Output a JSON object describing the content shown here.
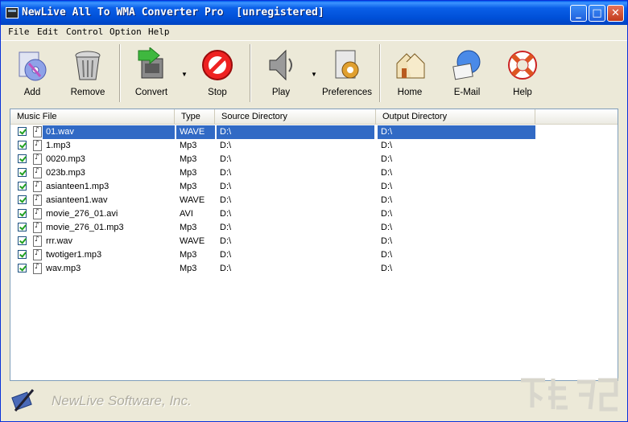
{
  "window": {
    "title": "NewLive All To WMA Converter Pro  [unregistered]",
    "controls": {
      "minimize": "_",
      "maximize": "□",
      "close": "✕"
    }
  },
  "menu": [
    "File",
    "Edit",
    "Control",
    "Option",
    "Help"
  ],
  "toolbar": {
    "add": "Add",
    "remove": "Remove",
    "convert": "Convert",
    "stop": "Stop",
    "play": "Play",
    "preferences": "Preferences",
    "home": "Home",
    "email": "E-Mail",
    "help": "Help"
  },
  "columns": [
    "Music File",
    "Type",
    "Source Directory",
    "Output Directory"
  ],
  "files": [
    {
      "name": "01.wav",
      "type": "WAVE",
      "src": "D:\\",
      "out": "D:\\",
      "selected": true
    },
    {
      "name": "1.mp3",
      "type": "Mp3",
      "src": "D:\\",
      "out": "D:\\"
    },
    {
      "name": "0020.mp3",
      "type": "Mp3",
      "src": "D:\\",
      "out": "D:\\"
    },
    {
      "name": "023b.mp3",
      "type": "Mp3",
      "src": "D:\\",
      "out": "D:\\"
    },
    {
      "name": "asianteen1.mp3",
      "type": "Mp3",
      "src": "D:\\",
      "out": "D:\\"
    },
    {
      "name": "asianteen1.wav",
      "type": "WAVE",
      "src": "D:\\",
      "out": "D:\\"
    },
    {
      "name": "movie_276_01.avi",
      "type": "AVI",
      "src": "D:\\",
      "out": "D:\\"
    },
    {
      "name": "movie_276_01.mp3",
      "type": "Mp3",
      "src": "D:\\",
      "out": "D:\\"
    },
    {
      "name": "rrr.wav",
      "type": "WAVE",
      "src": "D:\\",
      "out": "D:\\"
    },
    {
      "name": "twotiger1.mp3",
      "type": "Mp3",
      "src": "D:\\",
      "out": "D:\\"
    },
    {
      "name": "wav.mp3",
      "type": "Mp3",
      "src": "D:\\",
      "out": "D:\\"
    }
  ],
  "footer": {
    "brand": "NewLive Software, Inc."
  },
  "colors": {
    "titlebar": "#0A5FE8",
    "selection": "#316AC5",
    "face": "#ECE9D8",
    "check": "#21A121"
  }
}
